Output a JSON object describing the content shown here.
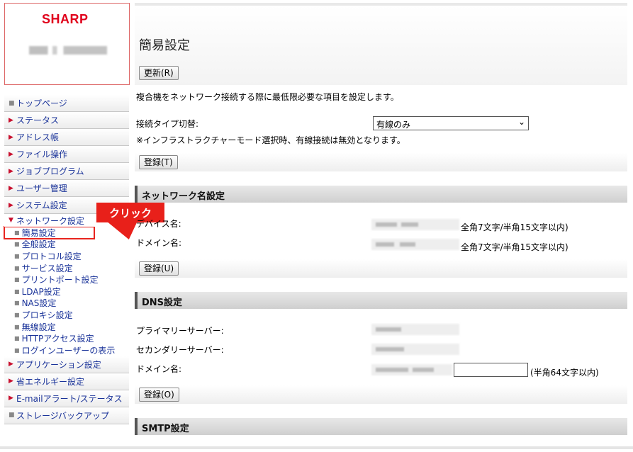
{
  "brand": {
    "name": "SHARP"
  },
  "menu": {
    "items": [
      {
        "label": "トップページ",
        "glyph": "■"
      },
      {
        "label": "ステータス",
        "glyph": "▶"
      },
      {
        "label": "アドレス帳",
        "glyph": "▶"
      },
      {
        "label": "ファイル操作",
        "glyph": "▶"
      },
      {
        "label": "ジョブプログラム",
        "glyph": "▶"
      },
      {
        "label": "ユーザー管理",
        "glyph": "▶"
      },
      {
        "label": "システム設定",
        "glyph": "▶"
      }
    ],
    "open": {
      "label": "ネットワーク設定",
      "glyph": "▼"
    },
    "sub": [
      {
        "label": "簡易設定"
      },
      {
        "label": "全般設定"
      },
      {
        "label": "プロトコル設定"
      },
      {
        "label": "サービス設定"
      },
      {
        "label": "プリントポート設定"
      },
      {
        "label": "LDAP設定"
      },
      {
        "label": "NAS設定"
      },
      {
        "label": "プロキシ設定"
      },
      {
        "label": "無線設定"
      },
      {
        "label": "HTTPアクセス設定"
      },
      {
        "label": "ログインユーザーの表示"
      }
    ],
    "after": [
      {
        "label": "アプリケーション設定",
        "glyph": "▶"
      },
      {
        "label": "省エネルギー設定",
        "glyph": "▶"
      },
      {
        "label": "E-mailアラート/ステータス",
        "glyph": "▶"
      },
      {
        "label": "ストレージバックアップ",
        "glyph": "■"
      }
    ]
  },
  "callout": {
    "label": "クリック"
  },
  "main": {
    "title": "簡易設定",
    "refresh": "更新(R)",
    "intro": "複合機をネットワーク接続する際に最低限必要な項目を設定します。",
    "conn_label": "接続タイプ切替:",
    "conn_value": "有線のみ",
    "conn_note": "※インフラストラクチャーモード選択時、有線接続は無効となります。",
    "register_t": "登録(T)",
    "netname": {
      "header": "ネットワーク名設定",
      "device_label": "デバイス名:",
      "device_hint": "全角7文字/半角15文字以内)",
      "domain_label": "ドメイン名:",
      "domain_hint": "全角7文字/半角15文字以内)",
      "register": "登録(U)"
    },
    "dns": {
      "header": "DNS設定",
      "primary_label": "プライマリーサーバー:",
      "secondary_label": "セカンダリーサーバー:",
      "domain_label": "ドメイン名:",
      "domain_hint": "(半角64文字以内)",
      "register": "登録(O)"
    },
    "smtp": {
      "header": "SMTP設定"
    }
  }
}
